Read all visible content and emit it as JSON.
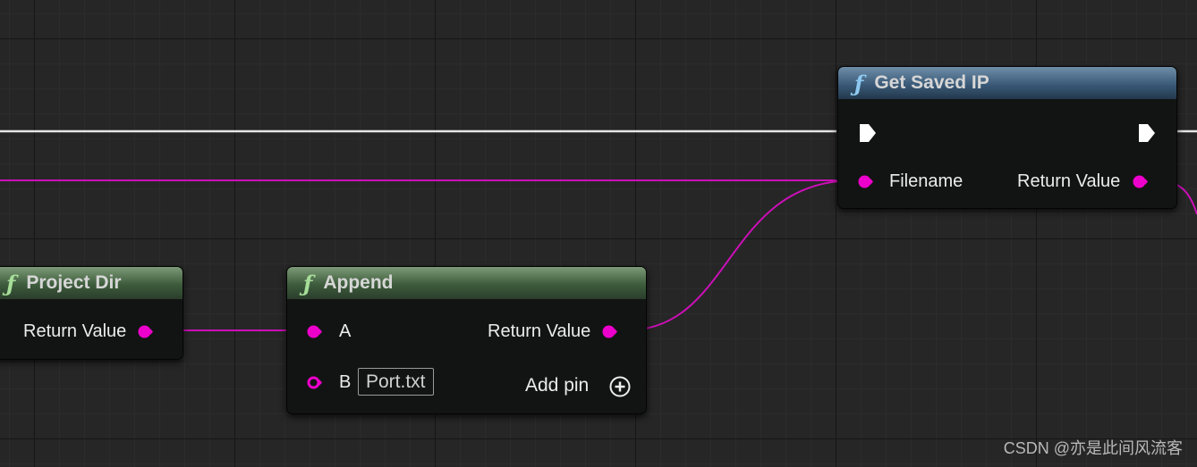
{
  "colors": {
    "string_pin": "#ee00cc",
    "exec_wire": "#e6e6e6",
    "func_icon_green": "#a6dd98",
    "func_icon_blue": "#8dc8f0"
  },
  "nodes": {
    "project_dir": {
      "title": "Project Dir",
      "icon": "function-icon",
      "return_label": "Return Value"
    },
    "append": {
      "title": "Append",
      "icon": "function-icon",
      "pin_a_label": "A",
      "pin_b_label": "B",
      "pin_b_value": "Port.txt",
      "return_label": "Return Value",
      "add_pin_label": "Add pin"
    },
    "get_saved_ip": {
      "title": "Get Saved IP",
      "icon": "function-icon",
      "filename_label": "Filename",
      "return_label": "Return Value"
    }
  },
  "watermark": "CSDN @亦是此间风流客"
}
